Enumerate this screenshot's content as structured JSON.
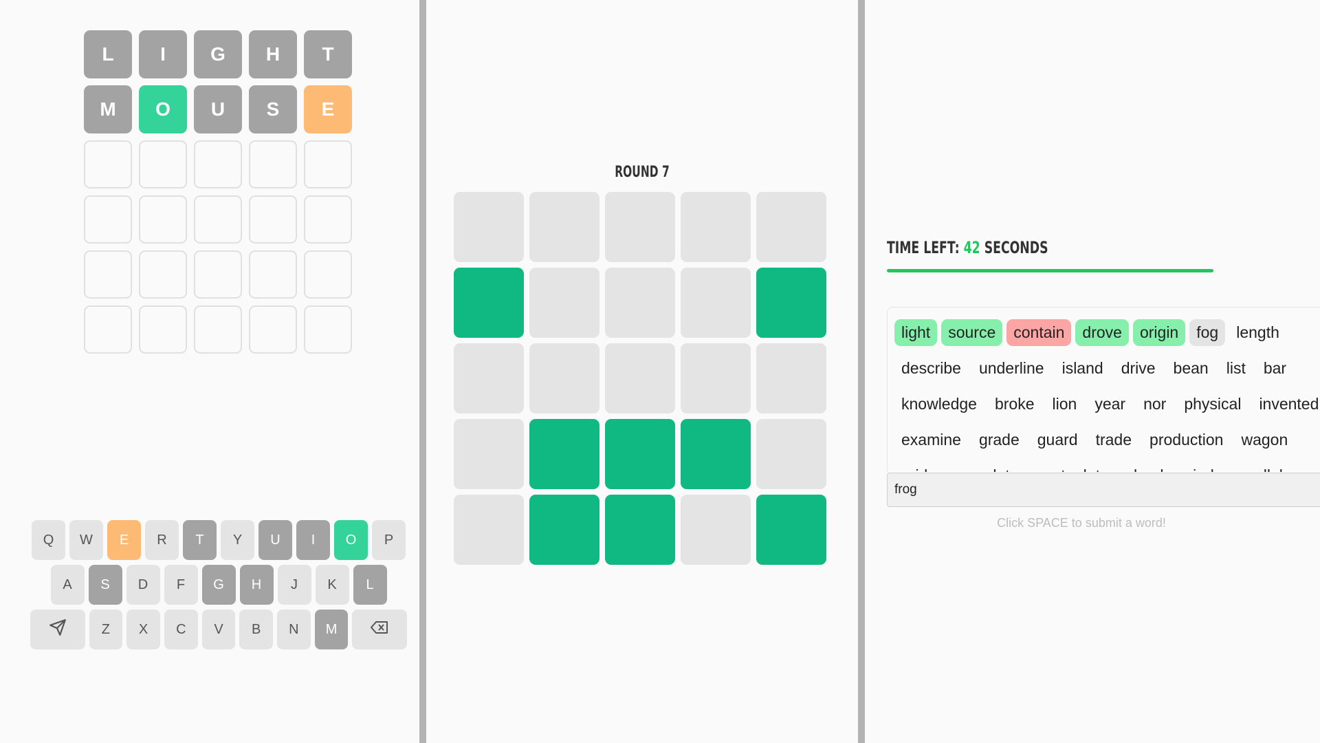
{
  "board": {
    "rows": [
      [
        {
          "l": "L",
          "s": "absent"
        },
        {
          "l": "I",
          "s": "absent"
        },
        {
          "l": "G",
          "s": "absent"
        },
        {
          "l": "H",
          "s": "absent"
        },
        {
          "l": "T",
          "s": "absent"
        }
      ],
      [
        {
          "l": "M",
          "s": "absent"
        },
        {
          "l": "O",
          "s": "correct"
        },
        {
          "l": "U",
          "s": "absent"
        },
        {
          "l": "S",
          "s": "absent"
        },
        {
          "l": "E",
          "s": "present"
        }
      ],
      [
        {
          "l": "",
          "s": "empty"
        },
        {
          "l": "",
          "s": "empty"
        },
        {
          "l": "",
          "s": "empty"
        },
        {
          "l": "",
          "s": "empty"
        },
        {
          "l": "",
          "s": "empty"
        }
      ],
      [
        {
          "l": "",
          "s": "empty"
        },
        {
          "l": "",
          "s": "empty"
        },
        {
          "l": "",
          "s": "empty"
        },
        {
          "l": "",
          "s": "empty"
        },
        {
          "l": "",
          "s": "empty"
        }
      ],
      [
        {
          "l": "",
          "s": "empty"
        },
        {
          "l": "",
          "s": "empty"
        },
        {
          "l": "",
          "s": "empty"
        },
        {
          "l": "",
          "s": "empty"
        },
        {
          "l": "",
          "s": "empty"
        }
      ],
      [
        {
          "l": "",
          "s": "empty"
        },
        {
          "l": "",
          "s": "empty"
        },
        {
          "l": "",
          "s": "empty"
        },
        {
          "l": "",
          "s": "empty"
        },
        {
          "l": "",
          "s": "empty"
        }
      ]
    ]
  },
  "keyboard": {
    "rows": [
      [
        {
          "k": "Q",
          "s": ""
        },
        {
          "k": "W",
          "s": ""
        },
        {
          "k": "E",
          "s": "present"
        },
        {
          "k": "R",
          "s": ""
        },
        {
          "k": "T",
          "s": "absent"
        },
        {
          "k": "Y",
          "s": ""
        },
        {
          "k": "U",
          "s": "absent"
        },
        {
          "k": "I",
          "s": "absent"
        },
        {
          "k": "O",
          "s": "correct"
        },
        {
          "k": "P",
          "s": ""
        }
      ],
      [
        {
          "k": "A",
          "s": ""
        },
        {
          "k": "S",
          "s": "absent"
        },
        {
          "k": "D",
          "s": ""
        },
        {
          "k": "F",
          "s": ""
        },
        {
          "k": "G",
          "s": "absent"
        },
        {
          "k": "H",
          "s": "absent"
        },
        {
          "k": "J",
          "s": ""
        },
        {
          "k": "K",
          "s": ""
        },
        {
          "k": "L",
          "s": "absent"
        }
      ],
      [
        {
          "k": "send-icon",
          "s": "",
          "wide": true
        },
        {
          "k": "Z",
          "s": ""
        },
        {
          "k": "X",
          "s": ""
        },
        {
          "k": "C",
          "s": ""
        },
        {
          "k": "V",
          "s": ""
        },
        {
          "k": "B",
          "s": ""
        },
        {
          "k": "N",
          "s": ""
        },
        {
          "k": "M",
          "s": "absent"
        },
        {
          "k": "backspace-icon",
          "s": "",
          "wide": true
        }
      ]
    ]
  },
  "round": {
    "label": "ROUND 7"
  },
  "pattern": [
    [
      0,
      0,
      0,
      0,
      0
    ],
    [
      1,
      0,
      0,
      0,
      1
    ],
    [
      0,
      0,
      0,
      0,
      0
    ],
    [
      0,
      1,
      1,
      1,
      0
    ],
    [
      0,
      1,
      1,
      0,
      1
    ]
  ],
  "timer": {
    "prefix": "TIME LEFT: ",
    "value": "42",
    "suffix": " SECONDS"
  },
  "word_list": {
    "rows": [
      [
        {
          "w": "light",
          "s": "ok"
        },
        {
          "w": "source",
          "s": "ok"
        },
        {
          "w": "contain",
          "s": "bad"
        },
        {
          "w": "drove",
          "s": "ok"
        },
        {
          "w": "origin",
          "s": "ok"
        },
        {
          "w": "fog",
          "s": "cur"
        },
        {
          "w": "length",
          "s": ""
        }
      ],
      [
        {
          "w": "describe",
          "s": ""
        },
        {
          "w": "underline",
          "s": ""
        },
        {
          "w": "island",
          "s": ""
        },
        {
          "w": "drive",
          "s": ""
        },
        {
          "w": "bean",
          "s": ""
        },
        {
          "w": "list",
          "s": ""
        },
        {
          "w": "bar",
          "s": ""
        }
      ],
      [
        {
          "w": "knowledge",
          "s": ""
        },
        {
          "w": "broke",
          "s": ""
        },
        {
          "w": "lion",
          "s": ""
        },
        {
          "w": "year",
          "s": ""
        },
        {
          "w": "nor",
          "s": ""
        },
        {
          "w": "physical",
          "s": ""
        },
        {
          "w": "invented",
          "s": ""
        }
      ],
      [
        {
          "w": "examine",
          "s": ""
        },
        {
          "w": "grade",
          "s": ""
        },
        {
          "w": "guard",
          "s": ""
        },
        {
          "w": "trade",
          "s": ""
        },
        {
          "w": "production",
          "s": ""
        },
        {
          "w": "wagon",
          "s": ""
        }
      ],
      [
        {
          "w": "pride",
          "s": ""
        },
        {
          "w": "complete",
          "s": ""
        },
        {
          "w": "cost",
          "s": ""
        },
        {
          "w": "lot",
          "s": ""
        },
        {
          "w": "school",
          "s": ""
        },
        {
          "w": "wind",
          "s": ""
        },
        {
          "w": "parallel",
          "s": ""
        }
      ]
    ]
  },
  "input": {
    "value": "frog"
  },
  "hint": "Click SPACE to submit a word!"
}
